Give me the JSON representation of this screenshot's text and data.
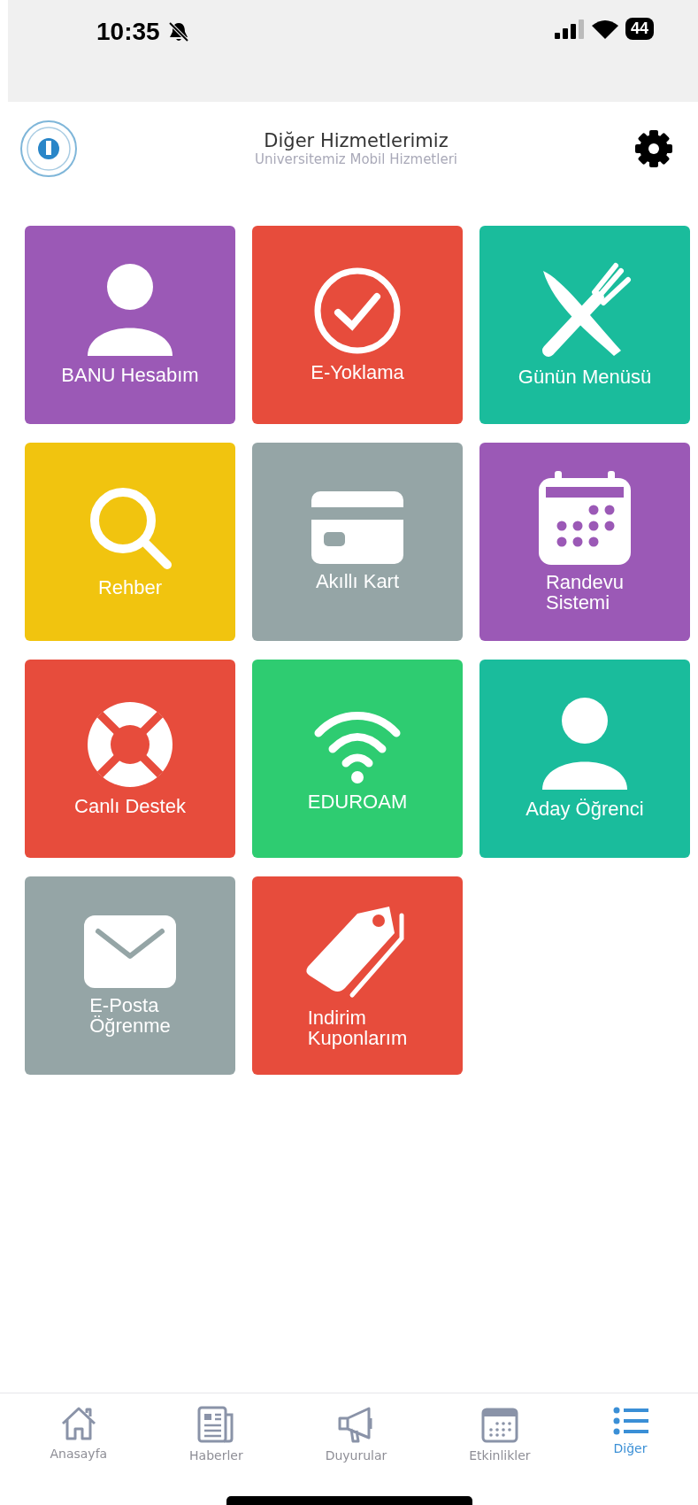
{
  "status_bar": {
    "time": "10:35",
    "battery": "44"
  },
  "header": {
    "title": "Diğer Hizmetlerimiz",
    "subtitle": "Universitemiz Mobil Hizmetleri"
  },
  "tiles": [
    {
      "label": "BANU Hesabım",
      "kind": "person",
      "color": "#9b59b6"
    },
    {
      "label": "E-Yoklama",
      "kind": "check",
      "color": "#e74c3c"
    },
    {
      "label": "Günün Menüsü",
      "kind": "cutlery",
      "color": "#1abc9c"
    },
    {
      "label": "Rehber",
      "kind": "search",
      "color": "#f1c40f"
    },
    {
      "label": "Akıllı Kart",
      "kind": "card",
      "color": "#95a5a6"
    },
    {
      "label": "Randevu\nSistemi",
      "kind": "calendar",
      "color": "#9b59b6"
    },
    {
      "label": "Canlı Destek",
      "kind": "lifebuoy",
      "color": "#e74c3c"
    },
    {
      "label": "EDUROAM",
      "kind": "wifi",
      "color": "#2ecc71"
    },
    {
      "label": "Aday Öğrenci",
      "kind": "person",
      "color": "#1abc9c"
    },
    {
      "label": "E-Posta\nÖğrenme",
      "kind": "mail",
      "color": "#95a5a6"
    },
    {
      "label": "Indirim\nKuponlarım",
      "kind": "tag",
      "color": "#e74c3c"
    }
  ],
  "tab_bar": [
    {
      "label": "Anasayfa",
      "kind": "home",
      "selected": false
    },
    {
      "label": "Haberler",
      "kind": "news",
      "selected": false
    },
    {
      "label": "Duyurular",
      "kind": "megaphone",
      "selected": false
    },
    {
      "label": "Etkinlikler",
      "kind": "calendar",
      "selected": false
    },
    {
      "label": "Diğer",
      "kind": "list",
      "selected": true
    }
  ]
}
